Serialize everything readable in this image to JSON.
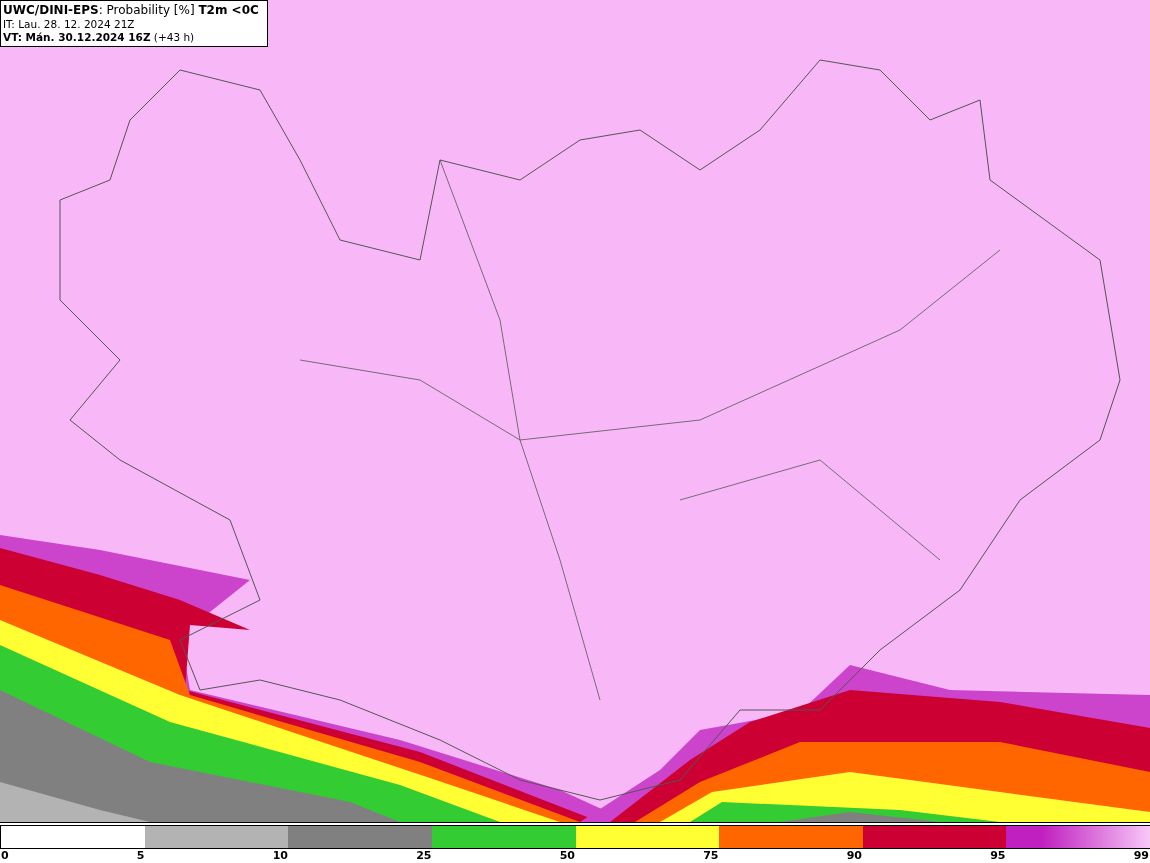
{
  "header": {
    "title": "**UWC/DINI-EPS**: Probability [%] **T2m <0C**",
    "init_time": "IT: Lau. 28. 12. 2024 21Z",
    "valid_time": "**VT: Mán. 30.12.2024 16Z** (+43 h)"
  },
  "colorbar": {
    "segments": [
      {
        "color": "#ffffff"
      },
      {
        "color": "#b3b3b3"
      },
      {
        "color": "#808080"
      },
      {
        "color": "#33cc33"
      },
      {
        "color": "#ffff33"
      },
      {
        "color": "#ff6600"
      },
      {
        "color": "#cc0033"
      },
      {
        "color": "#c020c0"
      }
    ],
    "ticks": [
      "0",
      "5",
      "10",
      "25",
      "50",
      "75",
      "90",
      "95",
      "99"
    ]
  }
}
